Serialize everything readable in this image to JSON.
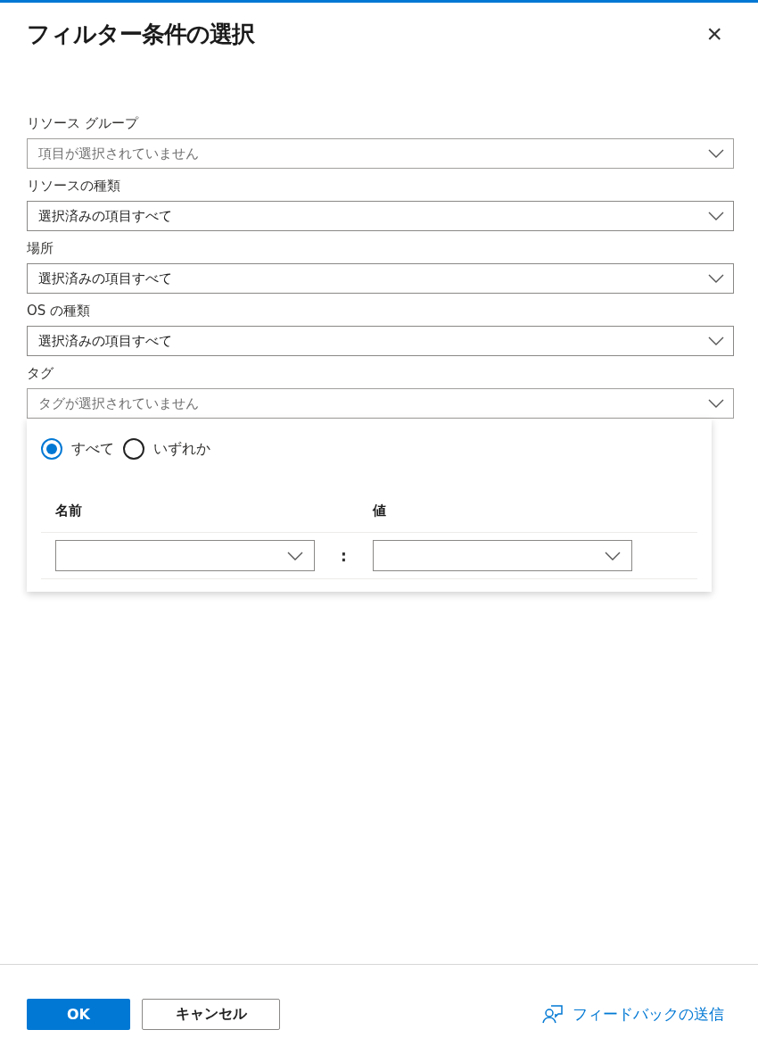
{
  "panel": {
    "title": "フィルター条件の選択",
    "close": "×"
  },
  "filters": [
    {
      "label": "リソース グループ",
      "placeholder": "項目が選択されていません"
    },
    {
      "label": "リソースの種類",
      "value": "選択済みの項目すべて"
    },
    {
      "label": "場所",
      "value": "選択済みの項目すべて"
    },
    {
      "label": "OS の種類",
      "value": "選択済みの項目すべて"
    },
    {
      "label": "タグ",
      "placeholder": "タグが選択されていません"
    }
  ],
  "tag_popup": {
    "match": [
      {
        "label": "すべて",
        "selected": true
      },
      {
        "label": "いずれか",
        "selected": false
      }
    ],
    "columns": [
      "名前",
      "値"
    ],
    "separator": ":"
  },
  "footer": {
    "ok": "OK",
    "cancel": "キャンセル",
    "feedback": "フィードバックの送信"
  }
}
